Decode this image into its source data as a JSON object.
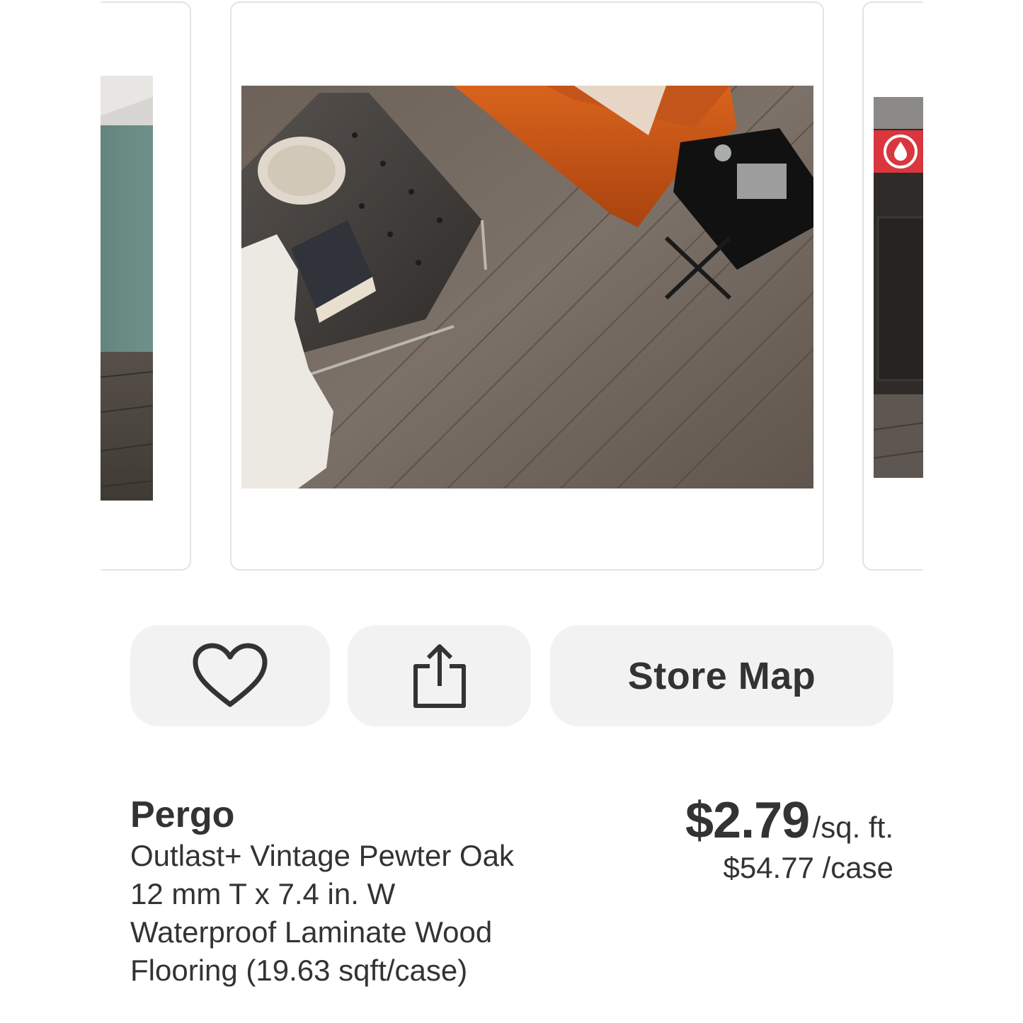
{
  "actions": {
    "favorite_icon": "heart-icon",
    "share_icon": "share-icon",
    "store_map_label": "Store Map"
  },
  "product": {
    "brand": "Pergo",
    "description_lines": [
      "Outlast+ Vintage Pewter Oak",
      "12 mm T x 7.4 in. W",
      "Waterproof Laminate Wood",
      "Flooring (19.63 sqft/case)"
    ],
    "price": "$2.79",
    "price_unit": "/sq. ft.",
    "case_price": "$54.77 /case"
  },
  "colors": {
    "button_bg": "#f2f2f2",
    "text": "#333333",
    "waterproof_badge": "#d9363e"
  }
}
